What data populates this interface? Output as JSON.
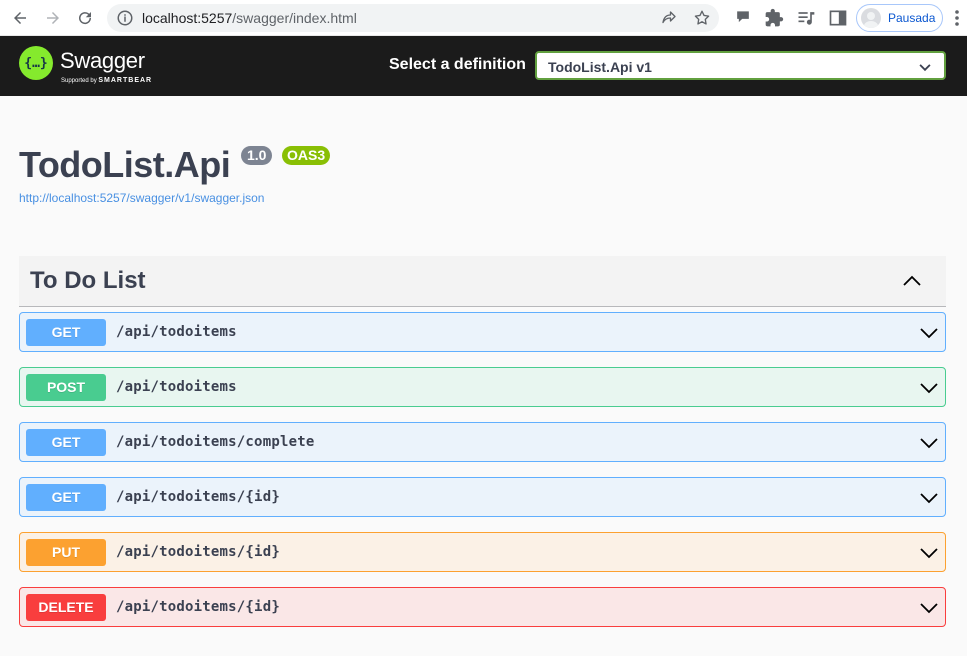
{
  "browser": {
    "url_host": "localhost:5257",
    "url_path": "/swagger/index.html",
    "profile_label": "Pausada"
  },
  "topbar": {
    "brand": "Swagger",
    "tagline_prefix": "Supported by",
    "tagline_brand": "SMARTBEAR",
    "select_label": "Select a definition",
    "selected_definition": "TodoList.Api v1"
  },
  "info": {
    "title": "TodoList.Api",
    "version": "1.0",
    "oas": "OAS3",
    "spec_url": "http://localhost:5257/swagger/v1/swagger.json"
  },
  "tag": {
    "name": "To Do List"
  },
  "operations": [
    {
      "method": "GET",
      "path": "/api/todoitems",
      "color": "#61affe",
      "bg": "#ebf3fb"
    },
    {
      "method": "POST",
      "path": "/api/todoitems",
      "color": "#49cc90",
      "bg": "#e8f6f0"
    },
    {
      "method": "GET",
      "path": "/api/todoitems/complete",
      "color": "#61affe",
      "bg": "#ebf3fb"
    },
    {
      "method": "GET",
      "path": "/api/todoitems/{id}",
      "color": "#61affe",
      "bg": "#ebf3fb"
    },
    {
      "method": "PUT",
      "path": "/api/todoitems/{id}",
      "color": "#fca130",
      "bg": "#fbf1e6"
    },
    {
      "method": "DELETE",
      "path": "/api/todoitems/{id}",
      "color": "#f93e3e",
      "bg": "#fae7e7"
    }
  ],
  "icons": {
    "logo": "swagger-logo-icon",
    "select_chevron": "chevron-down-icon",
    "tag_toggle": "chevron-up-icon",
    "op_toggle": "chevron-down-icon"
  }
}
